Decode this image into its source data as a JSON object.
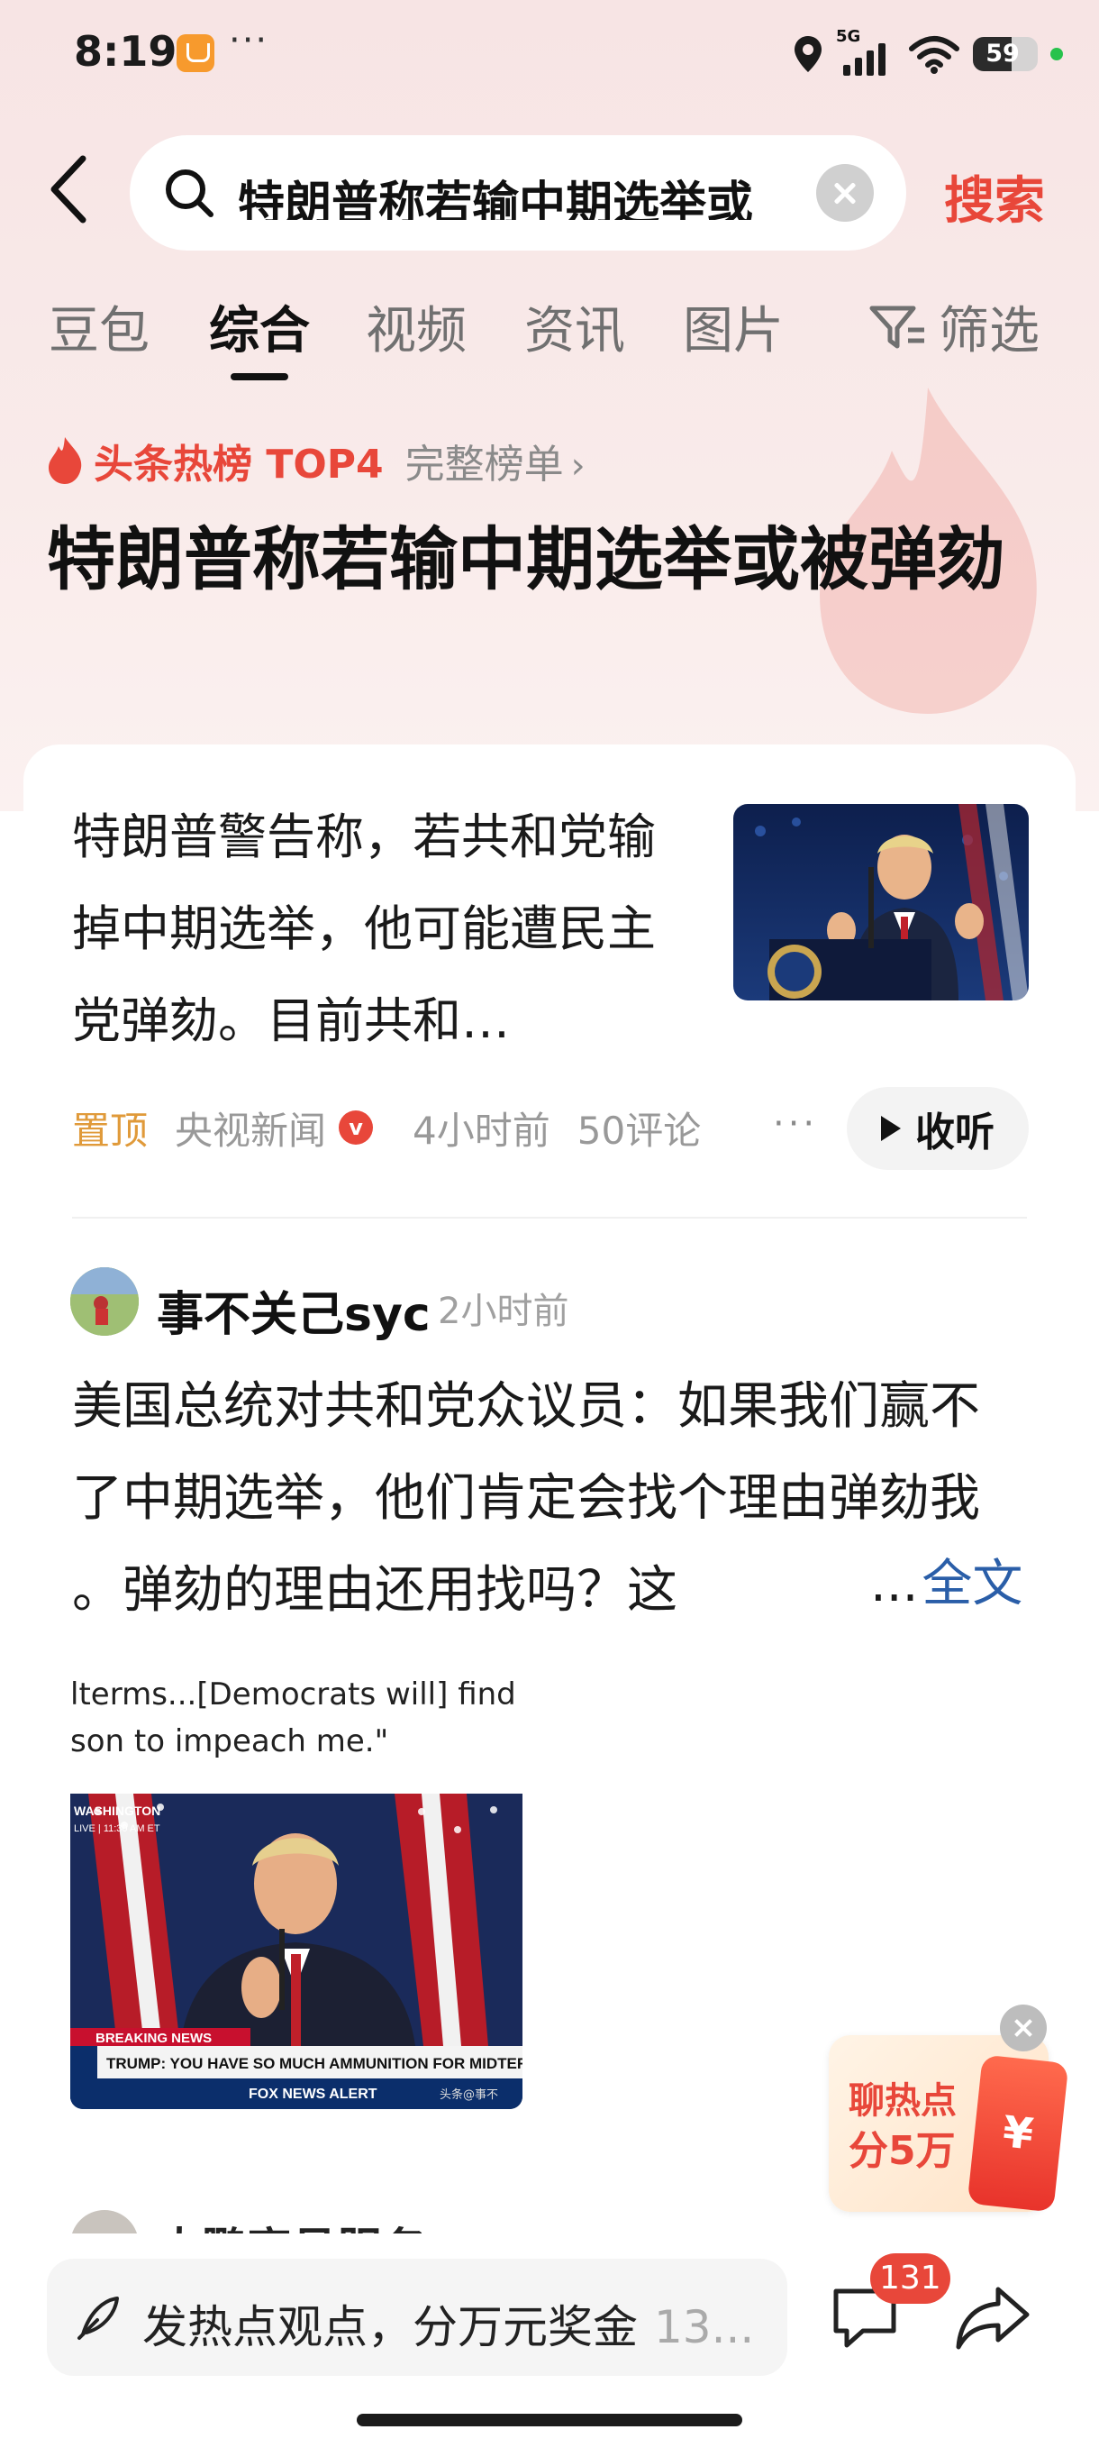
{
  "status_bar": {
    "time": "8:19",
    "more": "···",
    "network": "5G",
    "battery": "59"
  },
  "search": {
    "query": "特朗普称若输中期选举或",
    "button": "搜索"
  },
  "tabs": [
    {
      "label": "豆包"
    },
    {
      "label": "综合",
      "active": true
    },
    {
      "label": "视频"
    },
    {
      "label": "资讯"
    },
    {
      "label": "图片"
    }
  ],
  "filter_label": "筛选",
  "hot": {
    "label": "头条热榜 TOP4",
    "full_list": "完整榜单",
    "headline": "特朗普称若输中期选举或被弹劾"
  },
  "article": {
    "summary": "特朗普警告称，若共和党输掉中期选举，他可能遭民主党弹劾。目前共和…",
    "pinned": "置顶",
    "source": "央视新闻",
    "verified": "v",
    "time": "4小时前",
    "comments": "50评论",
    "more": "···",
    "listen": "收听"
  },
  "comment": {
    "user": "事不关己syc",
    "time": "2小时前",
    "text": "美国总统对共和党众议员：如果我们赢不了中期选举，他们肯定会找个理由弹劾我 。弹劾的理由还用找吗？这",
    "ellipsis": "...",
    "full_text": "全文",
    "image": {
      "caption_line1": "lterms...[Democrats will] find a",
      "caption_line2": "son to impeach me.\"",
      "location_tag": "WASHINGTON",
      "live_tag": "LIVE | 11:30 AM ET",
      "breaking": "BREAKING NEWS",
      "ticker": "TRUMP: YOU HAVE SO MUCH AMMUNITION FOR MIDTERM",
      "alert": "FOX NEWS ALERT",
      "watermark": "头条@事不"
    }
  },
  "next_user": "大鹏官员服务",
  "promo": {
    "line1": "聊热点",
    "line2": "分5万",
    "yen": "¥"
  },
  "bottom": {
    "placeholder": "发热点观点，分万元奖金",
    "count": "13...",
    "comment_count": "131"
  }
}
